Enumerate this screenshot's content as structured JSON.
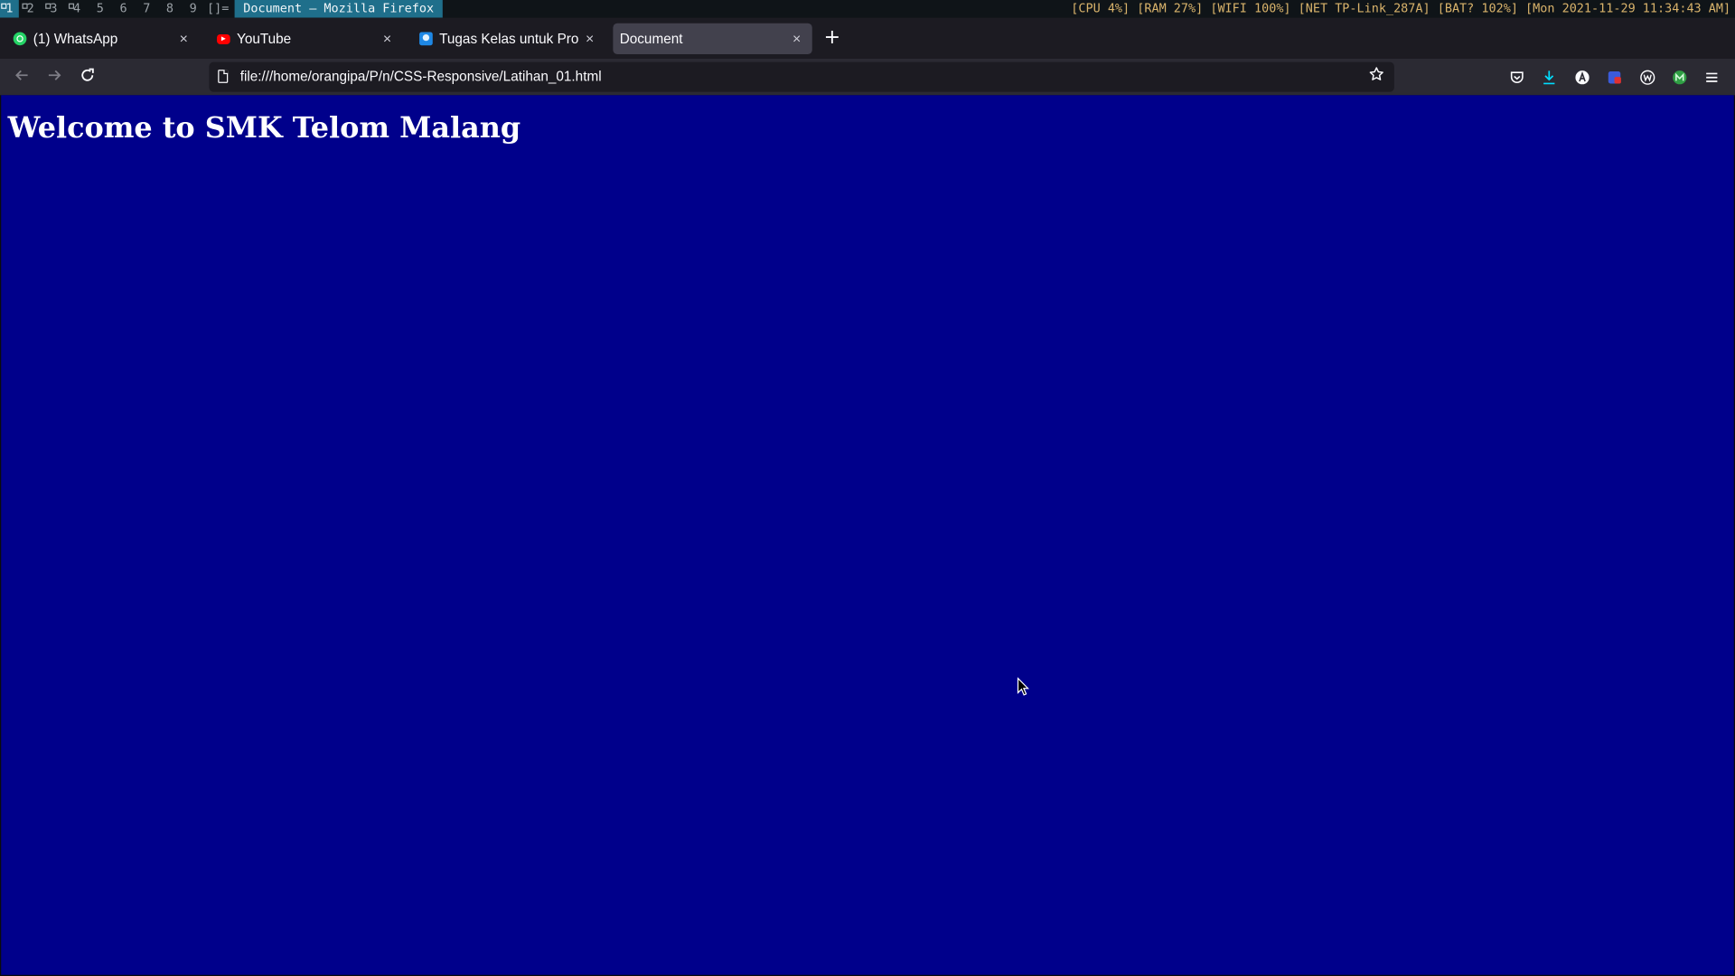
{
  "wm_bar": {
    "tags": [
      "1",
      "2",
      "3",
      "4",
      "5",
      "6",
      "7",
      "8",
      "9"
    ],
    "active_tag": "1",
    "layout_symbol": "[]=",
    "window_title": "Document — Mozilla Firefox",
    "status": "[CPU 4%] [RAM 27%] [WIFI 100%] [NET TP-Link_287A] [BAT? 102%] [Mon 2021-11-29 11:34:43 AM]"
  },
  "tabs": [
    {
      "label": "(1) WhatsApp",
      "icon": "whatsapp-icon",
      "selected": false
    },
    {
      "label": "YouTube",
      "icon": "youtube-icon",
      "selected": false
    },
    {
      "label": "Tugas Kelas untuk Produk",
      "icon": "classroom-icon",
      "selected": false
    },
    {
      "label": "Document",
      "icon": "none",
      "selected": true
    }
  ],
  "new_tab_label": "+",
  "close_glyph": "×",
  "navbar": {
    "back_icon": "back-arrow-icon",
    "forward_icon": "forward-arrow-icon",
    "reload_icon": "reload-icon",
    "url": "file:///home/orangipa/P/n/CSS-Responsive/Latihan_01.html",
    "bookmark_icon": "star-icon",
    "toolbar_icons": [
      "pocket-icon",
      "downloads-icon",
      "account-icon",
      "extension-shield-icon",
      "extension-w-icon",
      "extension-m-icon",
      "menu-icon"
    ]
  },
  "page": {
    "heading": "Welcome to SMK Telom Malang",
    "background_color": "#00008b",
    "text_color": "#ffffff"
  },
  "colors": {
    "wm_accent": "#1f6f8b",
    "status_text": "#d9b36b",
    "tab_strip": "#1c1b22",
    "toolbar": "#2b2a33",
    "downloads_accent": "#00ddff"
  }
}
